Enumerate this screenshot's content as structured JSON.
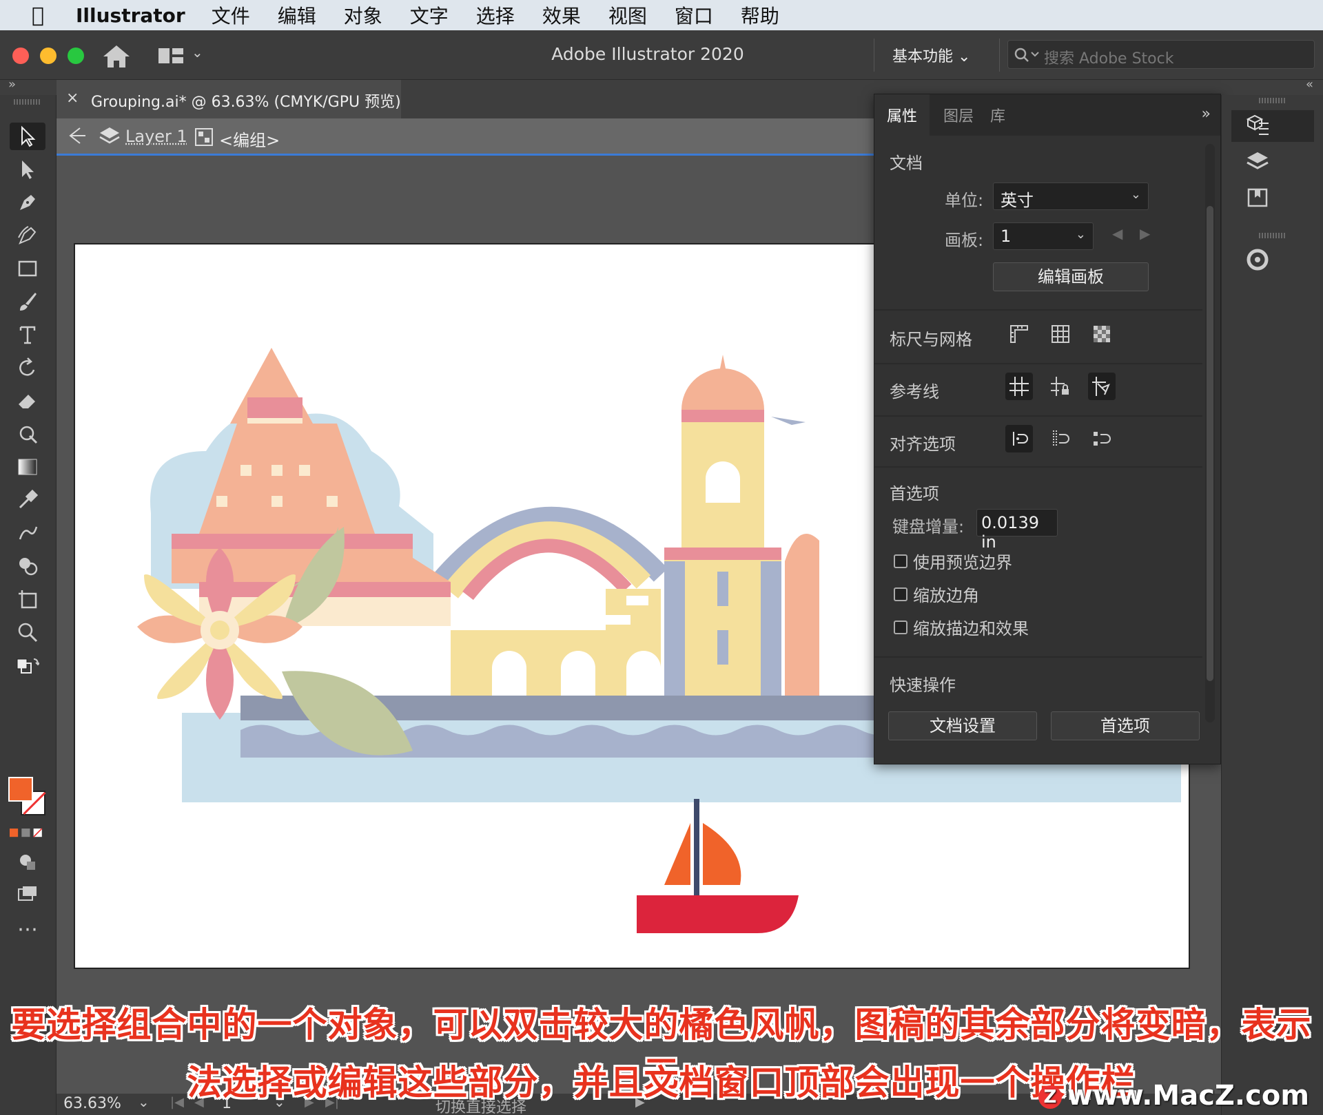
{
  "menubar": {
    "app_name": "Illustrator",
    "items": [
      "文件",
      "编辑",
      "对象",
      "文字",
      "选择",
      "效果",
      "视图",
      "窗口",
      "帮助"
    ]
  },
  "titlebar": {
    "title": "Adobe Illustrator 2020",
    "workspace": "基本功能",
    "search_placeholder": "搜索 Adobe Stock"
  },
  "document": {
    "tab_title": "Grouping.ai* @ 63.63% (CMYK/GPU 预览)",
    "close_glyph": "×"
  },
  "isolation": {
    "layer": "Layer 1",
    "group": "<编组>"
  },
  "panel": {
    "tabs": [
      "属性",
      "图层",
      "库"
    ],
    "active_tab": "属性",
    "document_section": "文档",
    "units_label": "单位:",
    "units_value": "英寸",
    "artboard_label": "画板:",
    "artboard_value": "1",
    "edit_artboards": "编辑画板",
    "rulers_grids": "标尺与网格",
    "guides": "参考线",
    "snap_options": "对齐选项",
    "preferences_section": "首选项",
    "keyboard_increment_label": "键盘增量:",
    "keyboard_increment_value": "0.0139 in",
    "checkboxes": [
      "使用预览边界",
      "缩放边角",
      "缩放描边和效果"
    ],
    "quick_actions": "快速操作",
    "document_setup": "文档设置",
    "preferences_button": "首选项"
  },
  "statusbar": {
    "zoom": "63.63%",
    "artboard": "1",
    "tool_hint": "切换直接选择"
  },
  "subtitle": {
    "line1": "要选择组合中的一个对象，可以双击较大的橘色风帆，图稿的其余部分将变暗，表示无",
    "line2": "法选择或编辑这些部分，并且文档窗口顶部会出现一个操作栏"
  },
  "watermark": "www.MacZ.com",
  "colors": {
    "fill": "#f0632a",
    "accent": "#3b7bd8"
  }
}
